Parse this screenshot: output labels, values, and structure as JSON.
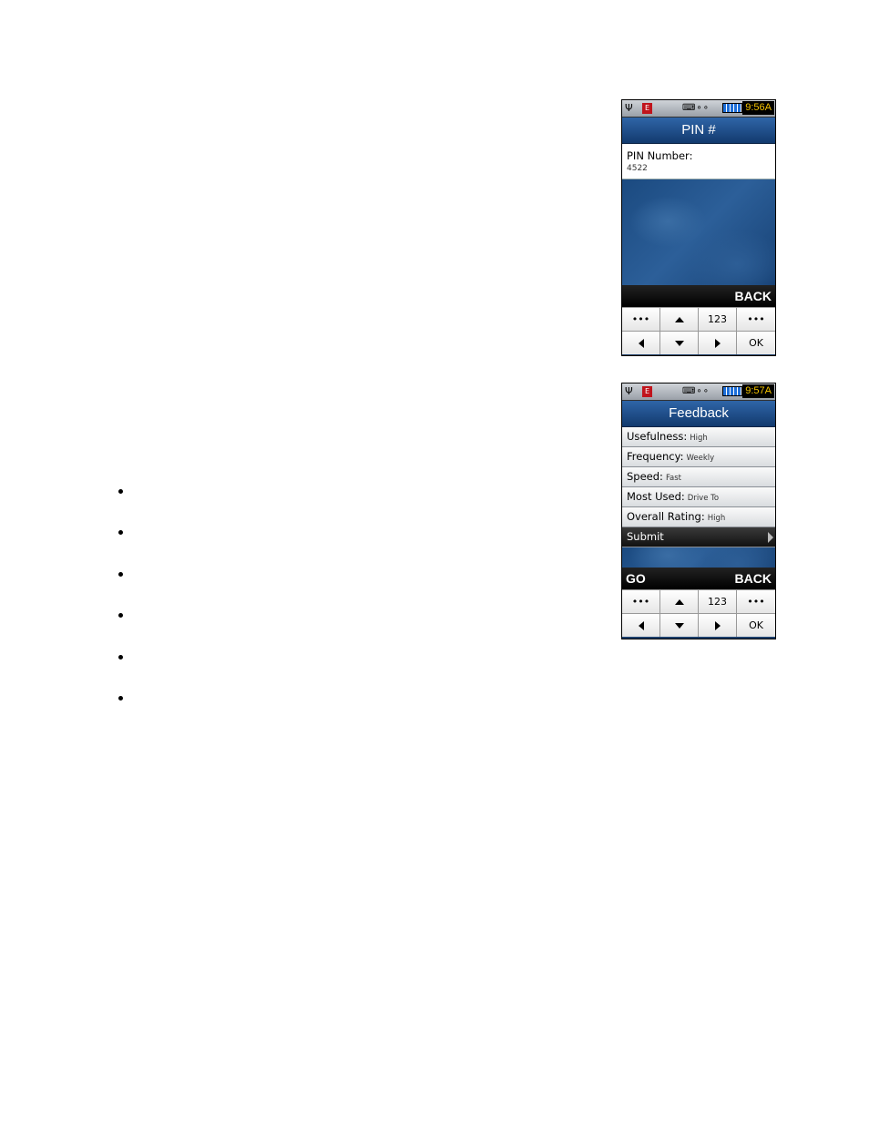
{
  "pin_screen": {
    "status_time": "9:56A",
    "title": "PIN #",
    "field_label": "PIN Number:",
    "field_value": "4522",
    "softkey_right": "BACK",
    "keypad": {
      "dots_left": "•••",
      "num": "123",
      "dots_right": "•••",
      "ok": "OK"
    }
  },
  "feedback_screen": {
    "status_time": "9:57A",
    "title": "Feedback",
    "items": [
      {
        "label": "Usefulness:",
        "value": "High"
      },
      {
        "label": "Frequency:",
        "value": "Weekly"
      },
      {
        "label": "Speed:",
        "value": "Fast"
      },
      {
        "label": "Most Used:",
        "value": "Drive To"
      },
      {
        "label": "Overall Rating:",
        "value": "High"
      }
    ],
    "submit_label": "Submit",
    "softkey_left": "GO",
    "softkey_right": "BACK",
    "keypad": {
      "dots_left": "•••",
      "num": "123",
      "dots_right": "•••",
      "ok": "OK"
    }
  }
}
